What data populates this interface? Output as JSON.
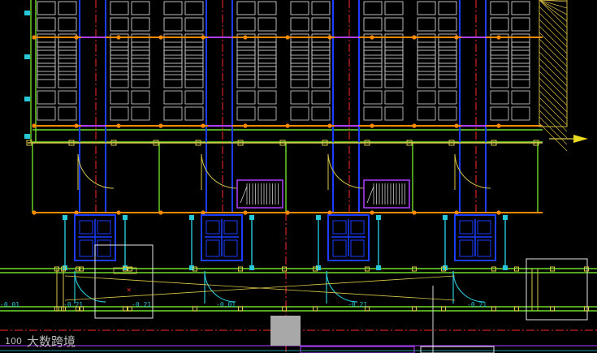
{
  "viewport": {
    "elevation_labels": [
      "-0.01",
      "-0.21",
      "-0.21",
      "-0.01",
      "-0.21",
      "-0.21"
    ]
  },
  "watermark": {
    "logo_text": "100",
    "brand_text": "大数跨境"
  },
  "colors": {
    "background": "#000000",
    "grid_orange": "#ff8a00",
    "grid_yellow": "#d8c84a",
    "wall_green": "#6fdc2a",
    "column_blue": "#1a3dff",
    "column_cyan": "#28c8d8",
    "axis_red": "#ff2a2a",
    "furniture_white": "#e6e6e6",
    "purple": "#b040ff",
    "hatch": "#c8b040",
    "arrow_yellow": "#e8d820"
  },
  "icons": {
    "direction_arrow": "arrow-right-icon"
  }
}
